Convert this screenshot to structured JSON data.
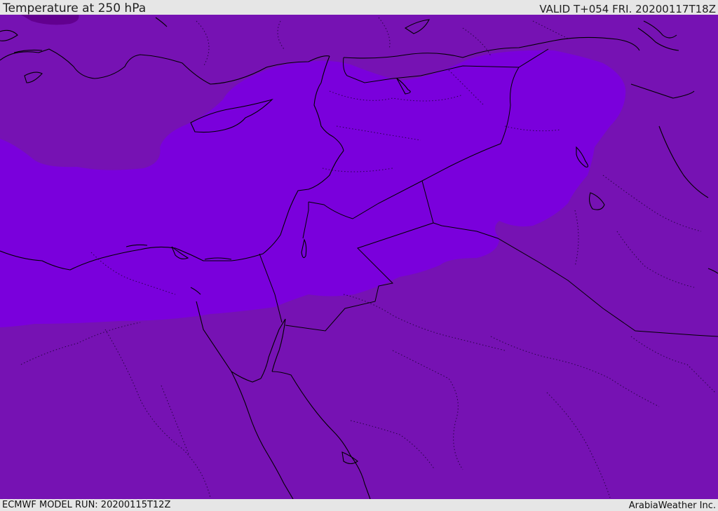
{
  "header": {
    "title": "Temperature at 250 hPa",
    "valid": "VALID T+054 FRI. 20200117T18Z"
  },
  "footer": {
    "model_run": "ECMWF MODEL RUN: 20200115T12Z",
    "credit": "ArabiaWeather Inc."
  },
  "map": {
    "colors": {
      "background_field": "#7612b3",
      "colder_field": "#7a00dc",
      "coldest_patch": "#62008f",
      "coastline": "#000000",
      "border": "#1a0033"
    }
  }
}
